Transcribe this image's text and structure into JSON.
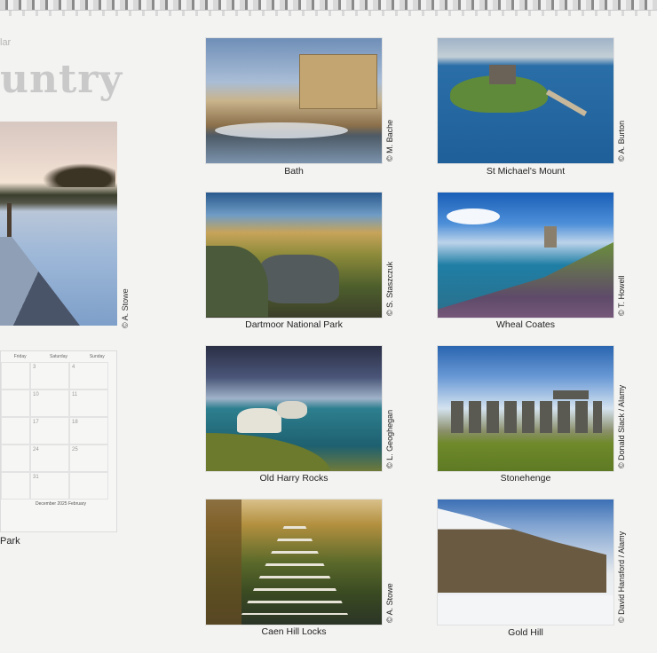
{
  "left_page": {
    "supertitle": "lar",
    "title": "untry",
    "photo_credit": "© A. Stowe",
    "calendar": {
      "day_headers": [
        "Friday",
        "Saturday",
        "Sunday"
      ],
      "cells": [
        "",
        "3",
        "4",
        "",
        "10",
        "11",
        "",
        "17",
        "18",
        "",
        "24",
        "25",
        "",
        "31",
        ""
      ],
      "mini_label": "December 2025    February"
    },
    "caption": "Park"
  },
  "tiles": [
    {
      "caption": "Bath",
      "credit": "© M. Bache"
    },
    {
      "caption": "St Michael's Mount",
      "credit": "© A. Burton"
    },
    {
      "caption": "Dartmoor National Park",
      "credit": "© S. Staszczuk"
    },
    {
      "caption": "Wheal Coates",
      "credit": "© T. Howell"
    },
    {
      "caption": "Old Harry Rocks",
      "credit": "© L. Geoghegan"
    },
    {
      "caption": "Stonehenge",
      "credit": "© Donald Slack / Alamy"
    },
    {
      "caption": "Caen Hill Locks",
      "credit": "© A. Stowe"
    },
    {
      "caption": "Gold Hill",
      "credit": "© David Hansford / Alamy"
    }
  ]
}
